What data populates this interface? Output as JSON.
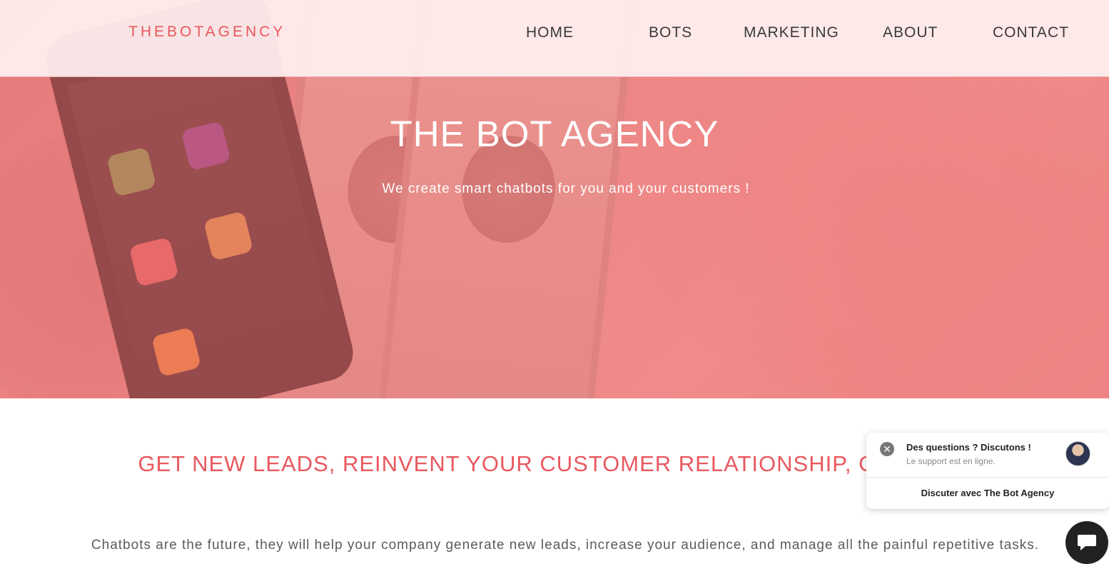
{
  "header": {
    "logo": "THEBOTAGENCY",
    "nav": [
      "HOME",
      "BOTS",
      "MARKETING",
      "ABOUT",
      "CONTACT"
    ]
  },
  "hero": {
    "title": "THE BOT AGENCY",
    "subtitle": "We create smart chatbots for you and your customers !"
  },
  "main": {
    "headline": "GET NEW LEADS, REINVENT YOUR CUSTOMER RELATIONSHIP, GO FUTURE",
    "body": "Chatbots are the future, they will help your company generate new leads, increase your audience, and manage all the painful repetitive tasks."
  },
  "chat_widget": {
    "close_icon": "close-icon",
    "title": "Des questions ? Discutons !",
    "status": "Le support est en ligne.",
    "cta": "Discuter avec The Bot Agency",
    "fab_icon": "chat-bubble-icon"
  },
  "colors": {
    "accent": "#e9585f",
    "hero_overlay": "#ee6c6c",
    "nav_text": "#3a3a3a",
    "fab": "#222222"
  }
}
